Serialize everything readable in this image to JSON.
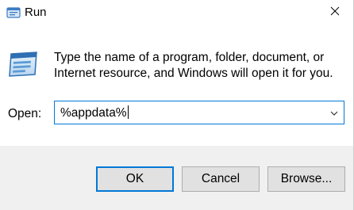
{
  "window": {
    "title": "Run",
    "title_icon": "run-app-icon",
    "close_icon": "close-icon"
  },
  "dialog": {
    "description": "Type the name of a program, folder, document, or Internet resource, and Windows will open it for you.",
    "main_icon": "run-dialog-icon",
    "open_label": "Open:",
    "open_value": "%appdata%",
    "dropdown_icon": "chevron-down-icon"
  },
  "buttons": {
    "ok": "OK",
    "cancel": "Cancel",
    "browse": "Browse..."
  },
  "colors": {
    "accent": "#0078d7",
    "footer_bg": "#f0f0f0",
    "button_bg": "#e1e1e1"
  }
}
